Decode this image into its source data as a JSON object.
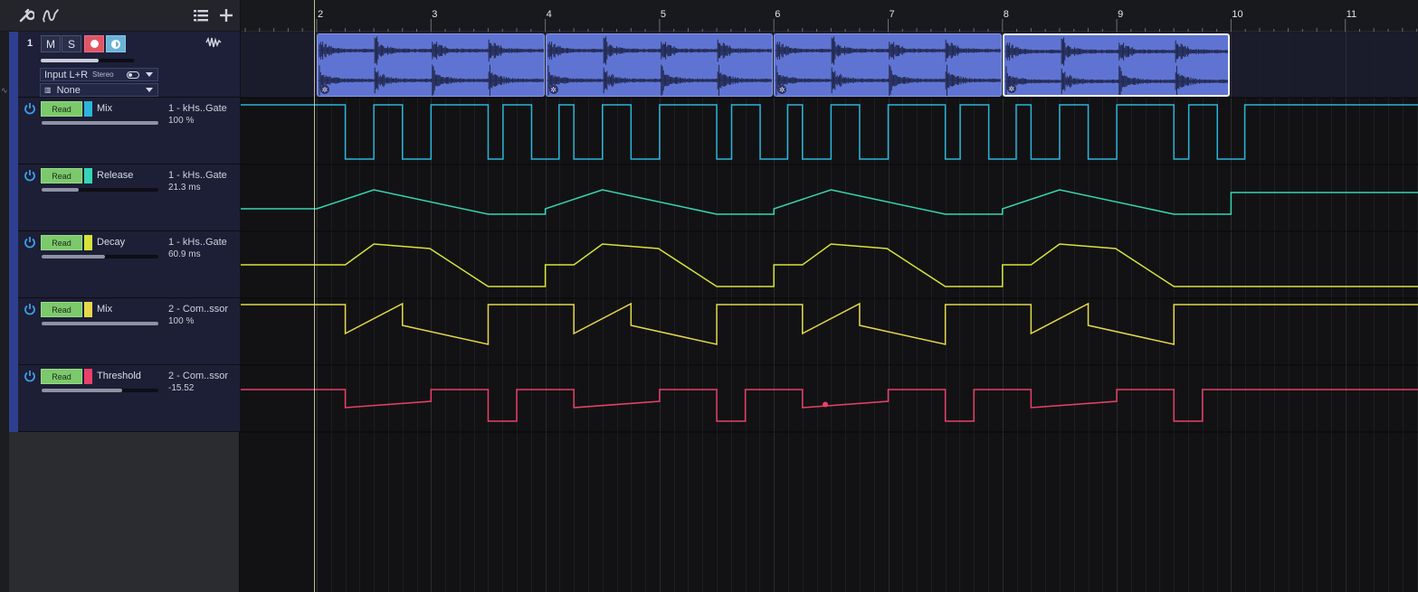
{
  "toolbar": {
    "tool_icon": "wrench-icon",
    "automation_icon": "automation-curve-icon",
    "list_icon": "list-icon",
    "add_icon": "plus-icon"
  },
  "track": {
    "number": "1",
    "mute_label": "M",
    "solo_label": "S",
    "input_label": "Input L+R",
    "input_format": "Stereo",
    "output_label": "None",
    "volume_fraction": 0.62,
    "color": "#2f3f8f"
  },
  "automation_lanes": [
    {
      "mode": "Read",
      "name": "Mix",
      "plugin": "1 - kHs..Gate",
      "value": "100 %",
      "color": "#2bb5d8",
      "level": 1.0
    },
    {
      "mode": "Read",
      "name": "Release",
      "plugin": "1 - kHs..Gate",
      "value": "21.3 ms",
      "color": "#36d6b4",
      "level": 0.32
    },
    {
      "mode": "Read",
      "name": "Decay",
      "plugin": "1 - kHs..Gate",
      "value": "60.9 ms",
      "color": "#d6e43a",
      "level": 0.54
    },
    {
      "mode": "Read",
      "name": "Mix",
      "plugin": "2 - Com..ssor",
      "value": "100 %",
      "color": "#e6d84a",
      "level": 1.0
    },
    {
      "mode": "Read",
      "name": "Threshold",
      "plugin": "2 - Com..ssor",
      "value": "-15.52",
      "color": "#e8416a",
      "level": 0.69
    }
  ],
  "ruler": {
    "bars": [
      "2",
      "3",
      "4",
      "5",
      "6",
      "7",
      "8",
      "9",
      "10",
      "11"
    ]
  },
  "clips": [
    {
      "selected": false
    },
    {
      "selected": false
    },
    {
      "selected": false
    },
    {
      "selected": true
    }
  ],
  "colors": {
    "clip": "#5f74d2",
    "track_header": "#1d2038",
    "read_mode": "#7cc96c",
    "record": "#e05565",
    "monitor": "#6ab4d8"
  }
}
